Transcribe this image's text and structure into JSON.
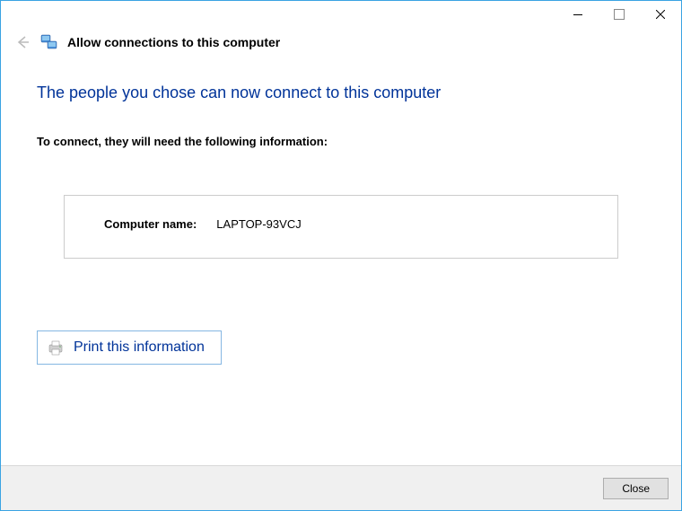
{
  "header": {
    "title": "Allow connections to this computer"
  },
  "main": {
    "heading": "The people you chose can now connect to this computer",
    "subtext": "To connect, they will need the following information:",
    "computer_name_label": "Computer name:",
    "computer_name_value": "LAPTOP-93VCJ"
  },
  "actions": {
    "print_label": "Print this information"
  },
  "footer": {
    "close_label": "Close"
  }
}
